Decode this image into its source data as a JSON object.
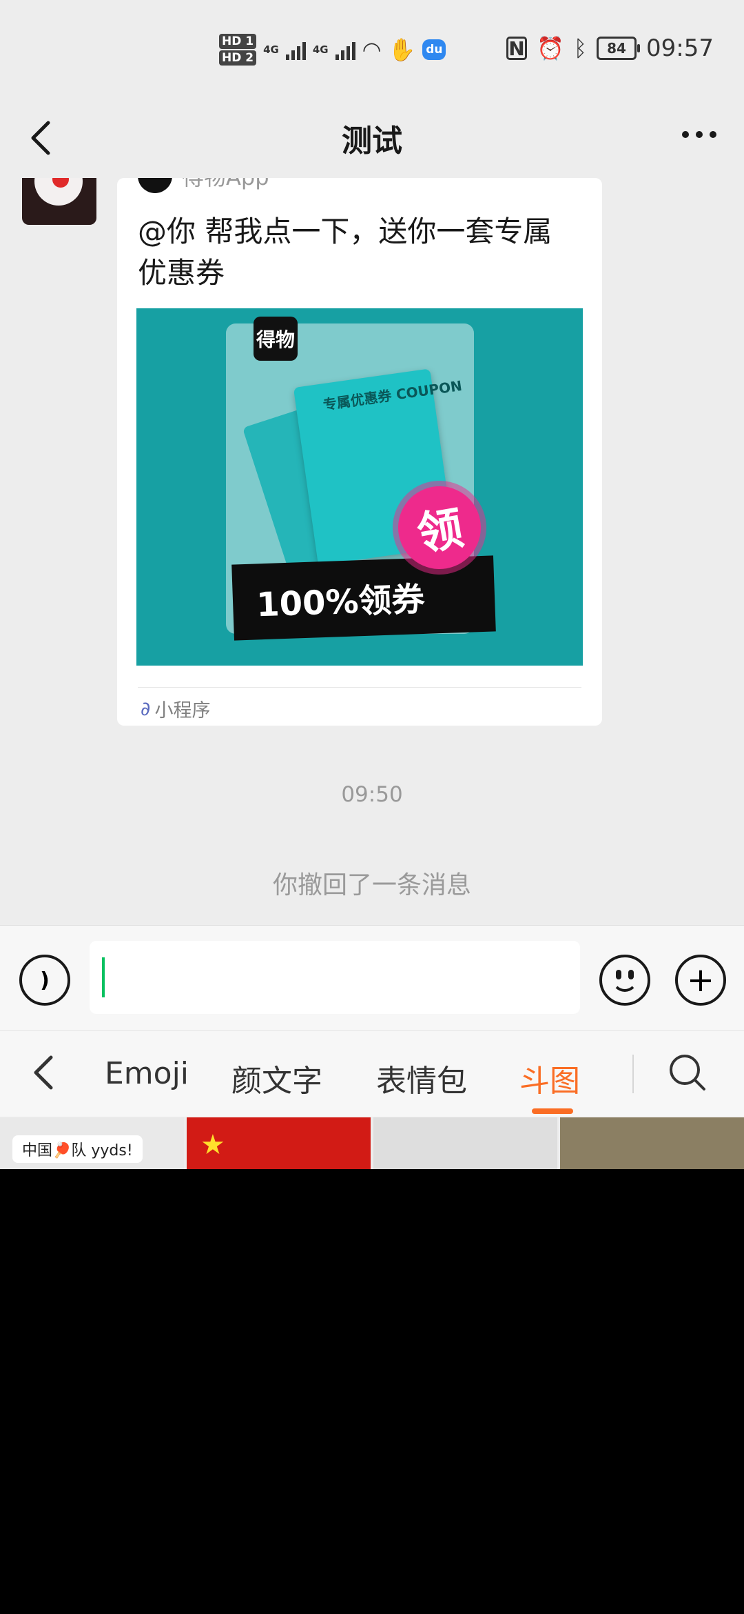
{
  "status_bar": {
    "sim1": "HD 1",
    "sim2": "HD 2",
    "network1": "4G",
    "network2": "4G",
    "battery": "84",
    "time": "09:57"
  },
  "header": {
    "title": "测试"
  },
  "chat": {
    "card": {
      "source": "得物App",
      "title": "@你 帮我点一下，送你一套专属优惠券",
      "image": {
        "logo_text": "得物",
        "coupon_text": "专属优惠券 COUPON",
        "badge": "领",
        "banner": "100%领券"
      },
      "footer_label": "小程序"
    },
    "timestamp": "09:50",
    "system_message": "你撤回了一条消息"
  },
  "emoji_panel": {
    "tabs": [
      {
        "label": "Emoji",
        "active": false
      },
      {
        "label": "颜文字",
        "active": false
      },
      {
        "label": "表情包",
        "active": false
      },
      {
        "label": "斗图",
        "active": true
      }
    ],
    "sticker_caption": "中国🏓队 yyds!"
  },
  "colors": {
    "accent": "#fa6d24",
    "caret": "#07c160",
    "card_image_bg": "#17a0a3"
  }
}
